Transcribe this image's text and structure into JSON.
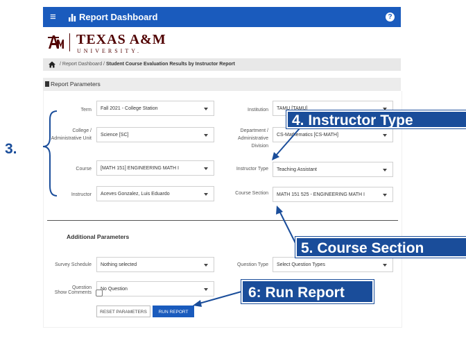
{
  "appbar": {
    "menu_icon": "hamburger-icon",
    "chart_icon": "bar-chart-icon",
    "title": "Report Dashboard",
    "help_icon": "help-icon",
    "help_glyph": "?"
  },
  "logo": {
    "name": "TEXAS A&M",
    "university": "UNIVERSITY."
  },
  "breadcrumb": {
    "home_icon": "home-icon",
    "sep1": " / ",
    "item1": "Report Dashboard",
    "sep2": " / ",
    "current": "Student Course Evaluation Results by Instructor Report"
  },
  "panel": {
    "title": "Report Parameters",
    "icon": "document-icon"
  },
  "fields": {
    "term": {
      "label": "Term",
      "value": "Fall 2021 - College Station"
    },
    "college": {
      "label1": "College /",
      "label2": "Administrative Unit",
      "value": "Science [SC]"
    },
    "course": {
      "label": "Course",
      "value": "[MATH 151] ENGINEERING MATH I"
    },
    "instructor": {
      "label": "Instructor",
      "value": "Aceves Gonzalez, Luis Eduardo"
    },
    "institution": {
      "label": "Institution",
      "value": "TAMU [TAMU]"
    },
    "department": {
      "label1": "Department /",
      "label2": "Administrative",
      "label3": "Division",
      "value": "CS-Mathematics [CS-MATH]"
    },
    "instructor_type": {
      "label": "Instructor Type",
      "value": "Teaching Assistant"
    },
    "course_section": {
      "label": "Course Section",
      "value": "MATH 151 525 - ENGINEERING MATH I"
    }
  },
  "additional": {
    "title": "Additional Parameters",
    "survey_schedule": {
      "label": "Survey Schedule",
      "value": "Nothing selected"
    },
    "question_type": {
      "label": "Question Type",
      "value": "Select Question Types"
    },
    "question": {
      "label": "Question",
      "value": "No Question"
    },
    "show_comments": {
      "label": "Show Comments",
      "checked": false
    }
  },
  "buttons": {
    "reset": "RESET PARAMETERS",
    "run": "RUN REPORT"
  },
  "annotations": {
    "step3": "3.",
    "step4": "4. Instructor Type",
    "step5": "5. Course Section",
    "step6": "6: Run Report"
  },
  "colors": {
    "appbar": "#1a5bbd",
    "maroon": "#500000",
    "callout": "#1a4d9a"
  }
}
